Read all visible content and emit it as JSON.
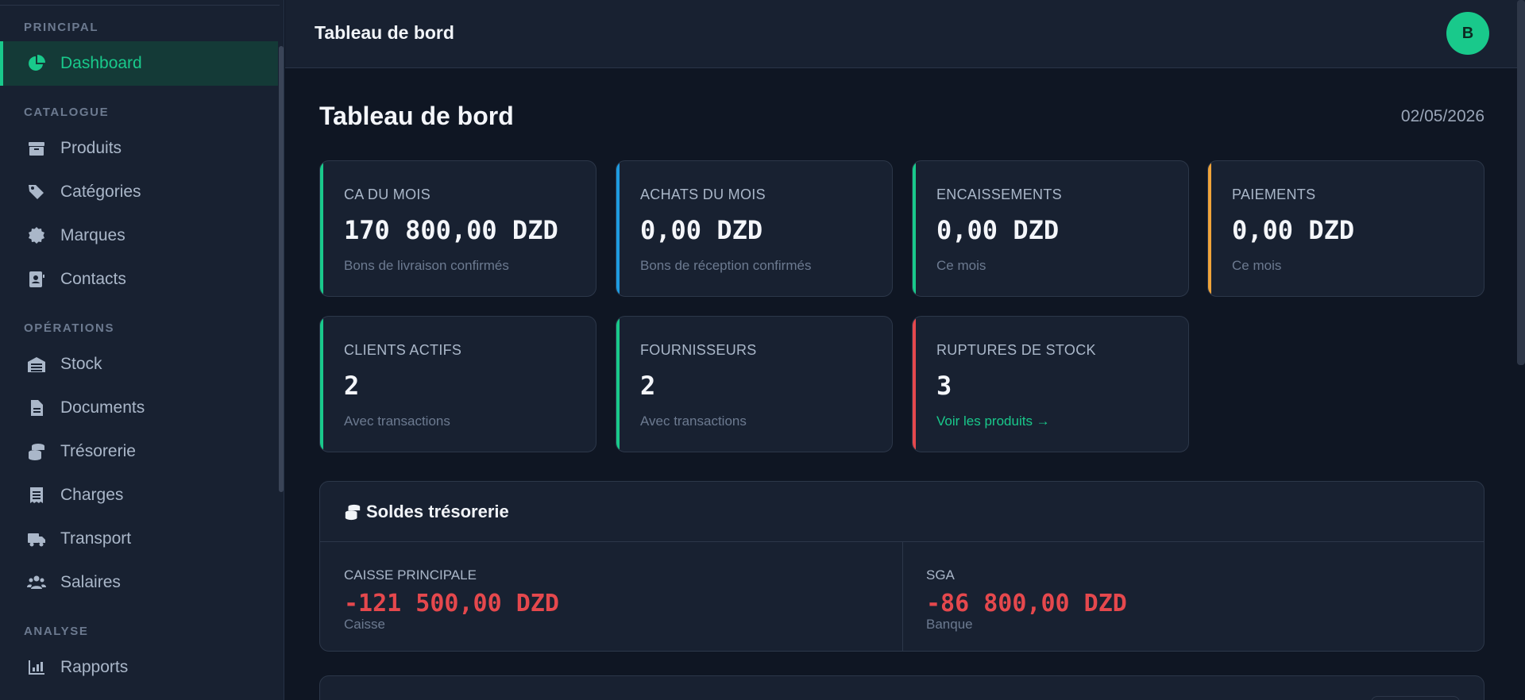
{
  "colors": {
    "accent": "#19c98b",
    "blue": "#1e9be0",
    "orange": "#f0a43a",
    "red": "#e5484d",
    "sidebar_bg": "#182131",
    "page_bg": "#0f1623"
  },
  "sidebar": {
    "sections": [
      {
        "label": "PRINCIPAL"
      },
      {
        "label": "CATALOGUE"
      },
      {
        "label": "OPÉRATIONS"
      },
      {
        "label": "ANALYSE"
      }
    ],
    "items": [
      {
        "label": "Dashboard",
        "icon": "pie-chart-icon",
        "active": true
      },
      {
        "label": "Produits",
        "icon": "box-icon"
      },
      {
        "label": "Catégories",
        "icon": "tags-icon"
      },
      {
        "label": "Marques",
        "icon": "badge-icon"
      },
      {
        "label": "Contacts",
        "icon": "address-book-icon"
      },
      {
        "label": "Stock",
        "icon": "warehouse-icon"
      },
      {
        "label": "Documents",
        "icon": "file-icon"
      },
      {
        "label": "Trésorerie",
        "icon": "coins-icon"
      },
      {
        "label": "Charges",
        "icon": "receipt-icon"
      },
      {
        "label": "Transport",
        "icon": "truck-icon"
      },
      {
        "label": "Salaires",
        "icon": "users-icon"
      },
      {
        "label": "Rapports",
        "icon": "bar-chart-icon"
      }
    ]
  },
  "header": {
    "title": "Tableau de bord",
    "avatar_initial": "B"
  },
  "main": {
    "title": "Tableau de bord",
    "date": "02/05/2026",
    "cards": [
      {
        "label": "CA DU MOIS",
        "value": "170 800,00 DZD",
        "sub": "Bons de livraison confirmés",
        "color": "#19c98b"
      },
      {
        "label": "ACHATS DU MOIS",
        "value": "0,00 DZD",
        "sub": "Bons de réception confirmés",
        "color": "#1e9be0"
      },
      {
        "label": "ENCAISSEMENTS",
        "value": "0,00 DZD",
        "sub": "Ce mois",
        "color": "#19c98b"
      },
      {
        "label": "PAIEMENTS",
        "value": "0,00 DZD",
        "sub": "Ce mois",
        "color": "#f0a43a"
      },
      {
        "label": "CLIENTS ACTIFS",
        "value": "2",
        "sub": "Avec transactions",
        "color": "#19c98b"
      },
      {
        "label": "FOURNISSEURS",
        "value": "2",
        "sub": "Avec transactions",
        "color": "#19c98b"
      },
      {
        "label": "RUPTURES DE STOCK",
        "value": "3",
        "sub": "Voir les produits →",
        "color": "#e5484d"
      }
    ],
    "treasury": {
      "title": "Soldes trésorerie",
      "accounts": [
        {
          "name": "CAISSE PRINCIPALE",
          "value": "-121 500,00 DZD",
          "type": "Caisse"
        },
        {
          "name": "SGA",
          "value": "-86 800,00 DZD",
          "type": "Banque"
        }
      ]
    }
  }
}
